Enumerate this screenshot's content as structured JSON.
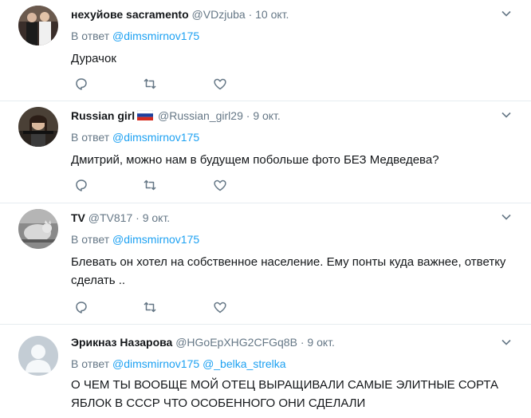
{
  "replying_label": "В ответ",
  "tweets": [
    {
      "fullname": "нехуйове sacramento",
      "username": "@VDzjuba",
      "dot": "·",
      "time": "10 окт.",
      "mentions": [
        "@dimsmirnov175"
      ],
      "text": "Дурачок",
      "avatar_icon": "photo-avatar-couple"
    },
    {
      "fullname": "Russian girl",
      "username": "@Russian_girl29",
      "dot": "·",
      "time": "9 окт.",
      "mentions": [
        "@dimsmirnov175"
      ],
      "text": "Дмитрий, можно нам в будущем побольше фото БЕЗ Медведева?",
      "avatar_icon": "photo-avatar-girl",
      "flag_icon": "russia-flag-icon"
    },
    {
      "fullname": "TV",
      "username": "@TV817",
      "dot": "·",
      "time": "9 окт.",
      "mentions": [
        "@dimsmirnov175"
      ],
      "text_lines": [
        "Блевать он хотел на собственное население. Ему понты куда важнее, ответку",
        "сделать .."
      ],
      "avatar_icon": "photo-avatar-cat"
    },
    {
      "fullname": "Эрикназ Назарова",
      "username": "@HGoEpXHG2CFGq8B",
      "dot": "·",
      "time": "9 окт.",
      "mentions": [
        "@dimsmirnov175",
        "@_belka_strelka"
      ],
      "text_lines": [
        "О ЧЕМ ТЫ ВООБЩЕ МОЙ ОТЕЦ ВЫРАЩИВАЛИ САМЫЕ ЭЛИТНЫЕ СОРТА",
        "ЯБЛОК В СССР ЧТО ОСОБЕННОГО ОНИ СДЕЛАЛИ"
      ],
      "avatar_icon": "default-avatar-icon"
    }
  ],
  "actions": [
    "reply-icon",
    "retweet-icon",
    "like-icon",
    "caret-down-icon"
  ],
  "colors": {
    "accent": "#1da1f2",
    "secondary_text": "#657786",
    "divider": "#e6ecf0",
    "icon": "#657786"
  }
}
